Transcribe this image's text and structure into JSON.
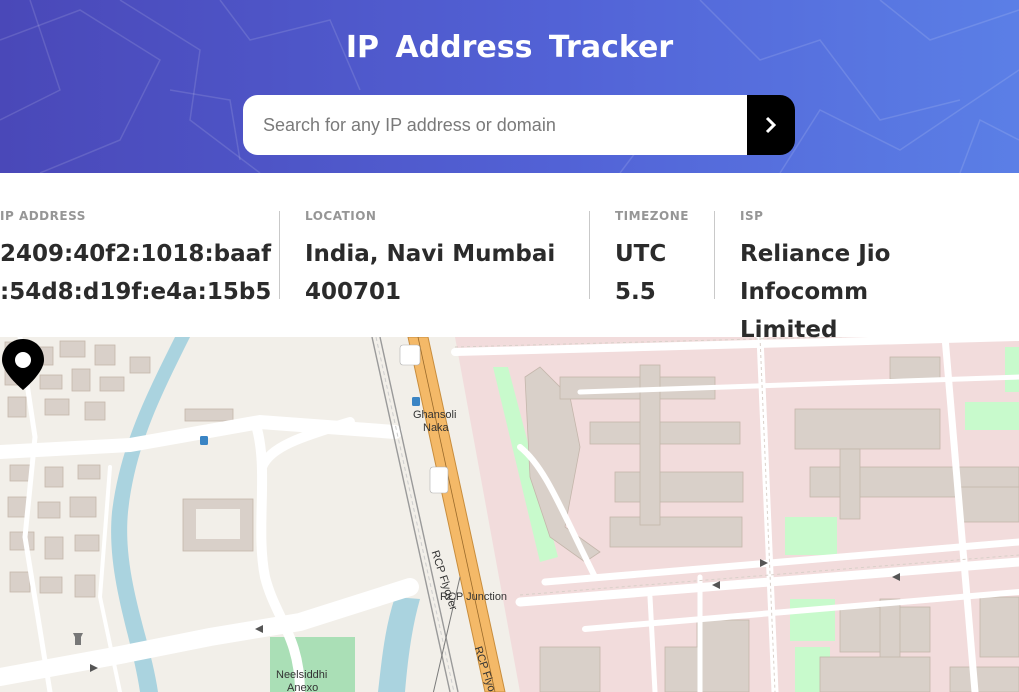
{
  "header": {
    "title": "IP Address Tracker",
    "search_placeholder": "Search for any IP address or domain",
    "search_value": "",
    "background_colors": [
      "#4a48b8",
      "#5b7fe6"
    ]
  },
  "info": {
    "ip_label": "IP ADDRESS",
    "ip_value_line1": "2409:40f2:1018:baaf",
    "ip_value_line2": ":54d8:d19f:e4a:15b5",
    "location_label": "LOCATION",
    "location_value_line1": "India, Navi Mumbai",
    "location_value_line2": "400701",
    "timezone_label": "TIMEZONE",
    "timezone_value_line1": "UTC",
    "timezone_value_line2": "5.5",
    "isp_label": "ISP",
    "isp_value_line1": "Reliance Jio Infocomm",
    "isp_value_line2": "Limited"
  },
  "map": {
    "labels": {
      "ghansoli_line1": "Ghansoli",
      "ghansoli_line2": "Naka",
      "rcp_junction": "RCP Junction",
      "rcp_flyover": "RCP Flyover",
      "rcp_flyover_2": "RCP Flyo",
      "neelsiddhi_line1": "Neelsiddhi",
      "neelsiddhi_line2": "Anexo"
    },
    "marker_icon": "location-pin-icon",
    "colors": {
      "residential": "#f2dcdc",
      "building": "#d9d0c9",
      "park": "#c8facc",
      "water": "#aad3df",
      "flyover": "#f4b968",
      "land": "#f2efe9"
    }
  }
}
